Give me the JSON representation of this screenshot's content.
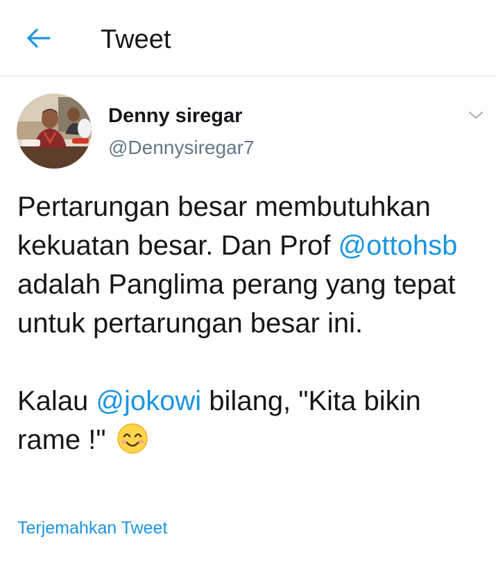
{
  "header": {
    "back_icon": "arrow-left-icon",
    "title": "Tweet"
  },
  "tweet": {
    "author": {
      "display_name": "Denny siregar",
      "handle": "@Dennysiregar7"
    },
    "menu_icon": "chevron-down-icon",
    "paragraph_1": {
      "part_1": "Pertarungan besar membutuhkan kekuatan besar. Dan Prof ",
      "mention_1": "@ottohsb",
      "part_2": " adalah Panglima perang yang tepat untuk pertarungan besar ini."
    },
    "paragraph_2": {
      "part_1": "Kalau ",
      "mention_1": "@jokowi",
      "part_2": " bilang, \"Kita bikin rame !\" ",
      "emoji": "smiling-face-emoji"
    },
    "translate_label": "Terjemahkan Tweet"
  },
  "colors": {
    "accent": "#1b95e0",
    "text_primary": "#14171a",
    "text_secondary": "#657786",
    "divider": "#e1e8ed"
  }
}
